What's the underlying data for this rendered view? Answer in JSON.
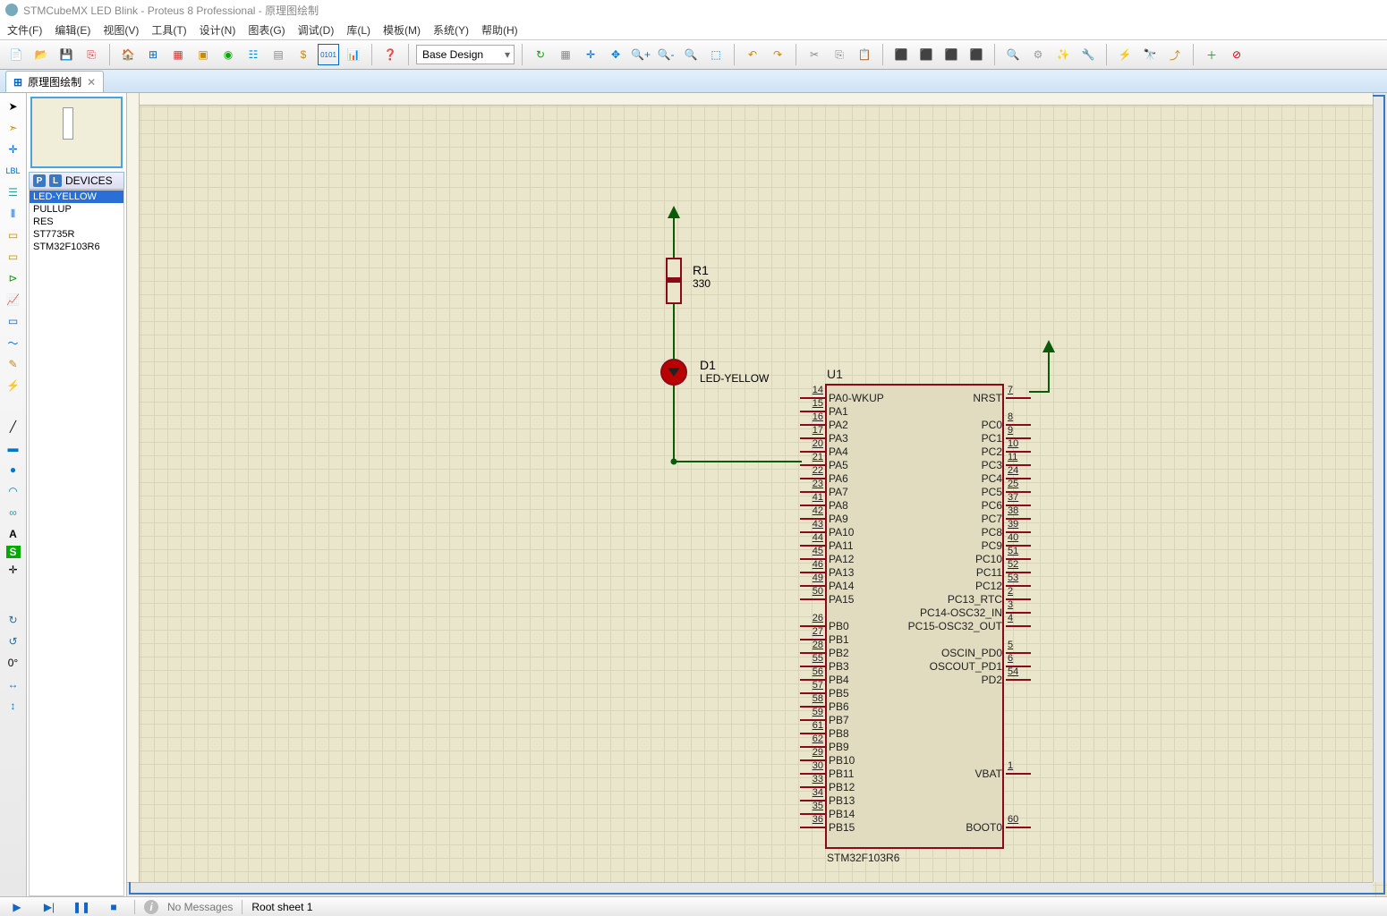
{
  "title": "STMCubeMX LED Blink - Proteus 8 Professional - 原理图绘制",
  "menus": [
    "文件(F)",
    "编辑(E)",
    "视图(V)",
    "工具(T)",
    "设计(N)",
    "图表(G)",
    "调试(D)",
    "库(L)",
    "模板(M)",
    "系统(Y)",
    "帮助(H)"
  ],
  "designCombo": "Base Design",
  "tab": {
    "title": "原理图绘制"
  },
  "devicesHeader": "DEVICES",
  "devices": [
    "LED-YELLOW",
    "PULLUP",
    "RES",
    "ST7735R",
    "STM32F103R6"
  ],
  "selectedDevice": "LED-YELLOW",
  "statusMsg": "No Messages",
  "statusSheet": "Root sheet 1",
  "angle": "0°",
  "components": {
    "resistor": {
      "ref": "R1",
      "value": "330"
    },
    "led": {
      "ref": "D1",
      "value": "LED-YELLOW"
    },
    "chip": {
      "ref": "U1",
      "part": "STM32F103R6"
    }
  },
  "pinsLeft": [
    {
      "num": "14",
      "name": "PA0-WKUP"
    },
    {
      "num": "15",
      "name": "PA1"
    },
    {
      "num": "16",
      "name": "PA2"
    },
    {
      "num": "17",
      "name": "PA3"
    },
    {
      "num": "20",
      "name": "PA4"
    },
    {
      "num": "21",
      "name": "PA5"
    },
    {
      "num": "22",
      "name": "PA6"
    },
    {
      "num": "23",
      "name": "PA7"
    },
    {
      "num": "41",
      "name": "PA8"
    },
    {
      "num": "42",
      "name": "PA9"
    },
    {
      "num": "43",
      "name": "PA10"
    },
    {
      "num": "44",
      "name": "PA11"
    },
    {
      "num": "45",
      "name": "PA12"
    },
    {
      "num": "46",
      "name": "PA13"
    },
    {
      "num": "49",
      "name": "PA14"
    },
    {
      "num": "50",
      "name": "PA15"
    },
    {
      "gap": true
    },
    {
      "num": "26",
      "name": "PB0"
    },
    {
      "num": "27",
      "name": "PB1"
    },
    {
      "num": "28",
      "name": "PB2"
    },
    {
      "num": "55",
      "name": "PB3"
    },
    {
      "num": "56",
      "name": "PB4"
    },
    {
      "num": "57",
      "name": "PB5"
    },
    {
      "num": "58",
      "name": "PB6"
    },
    {
      "num": "59",
      "name": "PB7"
    },
    {
      "num": "61",
      "name": "PB8"
    },
    {
      "num": "62",
      "name": "PB9"
    },
    {
      "num": "29",
      "name": "PB10"
    },
    {
      "num": "30",
      "name": "PB11"
    },
    {
      "num": "33",
      "name": "PB12"
    },
    {
      "num": "34",
      "name": "PB13"
    },
    {
      "num": "35",
      "name": "PB14"
    },
    {
      "num": "36",
      "name": "PB15"
    }
  ],
  "pinsRight": [
    {
      "num": "7",
      "name": "NRST"
    },
    {
      "gap": true
    },
    {
      "num": "8",
      "name": "PC0"
    },
    {
      "num": "9",
      "name": "PC1"
    },
    {
      "num": "10",
      "name": "PC2"
    },
    {
      "num": "11",
      "name": "PC3"
    },
    {
      "num": "24",
      "name": "PC4"
    },
    {
      "num": "25",
      "name": "PC5"
    },
    {
      "num": "37",
      "name": "PC6"
    },
    {
      "num": "38",
      "name": "PC7"
    },
    {
      "num": "39",
      "name": "PC8"
    },
    {
      "num": "40",
      "name": "PC9"
    },
    {
      "num": "51",
      "name": "PC10"
    },
    {
      "num": "52",
      "name": "PC11"
    },
    {
      "num": "53",
      "name": "PC12"
    },
    {
      "num": "2",
      "name": "PC13_RTC"
    },
    {
      "num": "3",
      "name": "PC14-OSC32_IN"
    },
    {
      "num": "4",
      "name": "PC15-OSC32_OUT"
    },
    {
      "gap": true
    },
    {
      "num": "5",
      "name": "OSCIN_PD0"
    },
    {
      "num": "6",
      "name": "OSCOUT_PD1"
    },
    {
      "num": "54",
      "name": "PD2"
    },
    {
      "gap": true
    },
    {
      "gap": true
    },
    {
      "gap": true
    },
    {
      "gap": true
    },
    {
      "gap": true
    },
    {
      "gap": true
    },
    {
      "num": "1",
      "name": "VBAT"
    },
    {
      "gap": true
    },
    {
      "gap": true
    },
    {
      "gap": true
    },
    {
      "num": "60",
      "name": "BOOT0"
    }
  ]
}
